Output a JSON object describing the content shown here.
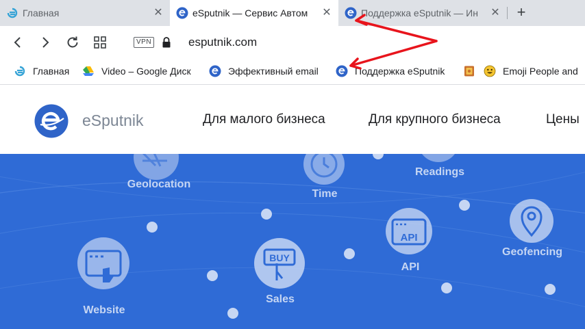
{
  "tabs": [
    {
      "title": "Главная",
      "icon": "esputnik-logo-icon",
      "active": false
    },
    {
      "title": "eSputnik — Сервис Автом",
      "icon": "esputnik-logo-icon",
      "active": true
    },
    {
      "title": "Поддержка eSputnik — Ин",
      "icon": "esputnik-logo-icon",
      "active": false
    }
  ],
  "toolbar": {
    "vpn_label": "VPN",
    "url": "esputnik.com"
  },
  "bookmarks": [
    {
      "label": "Главная",
      "icon": "esputnik-logo-icon"
    },
    {
      "label": "Video – Google Диск",
      "icon": "google-drive-icon"
    },
    {
      "label": "Эффективный email",
      "icon": "esputnik-logo-icon"
    },
    {
      "label": "Поддержка eSputnik",
      "icon": "esputnik-logo-icon"
    },
    {
      "label": "",
      "icon": "book-icon"
    },
    {
      "label": "Emoji People and",
      "icon": "smiley-emoji-icon"
    }
  ],
  "site": {
    "name": "eSputnik",
    "nav": [
      "Для малого бизнеса",
      "Для крупного бизнеса",
      "Цены"
    ]
  },
  "hero": {
    "labels": [
      "Geolocation",
      "Time",
      "Readings",
      "Website",
      "Sales",
      "API",
      "Geofencing"
    ],
    "icon_texts": {
      "buy": "BUY",
      "api": "API"
    }
  },
  "colors": {
    "brand_blue": "#2f6bd6",
    "annotation_red": "#e8141c",
    "tabstrip": "#dee1e6"
  }
}
